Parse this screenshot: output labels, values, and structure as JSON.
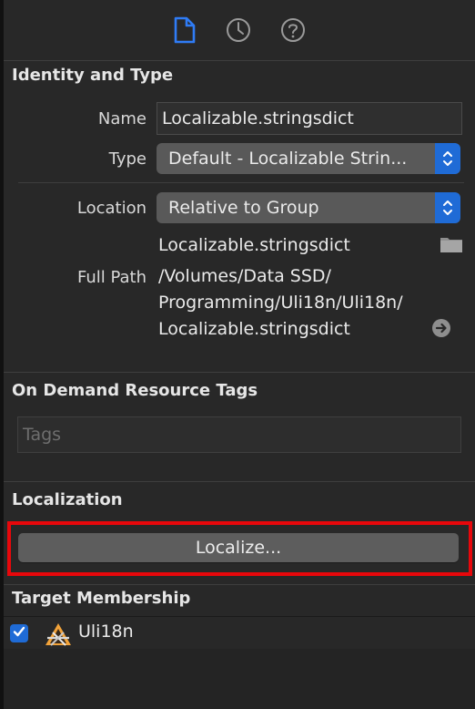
{
  "tabs": [
    {
      "name": "file-inspector",
      "icon": "document-icon",
      "active": true
    },
    {
      "name": "history-inspector",
      "icon": "clock-icon",
      "active": false
    },
    {
      "name": "quick-help",
      "icon": "question-icon",
      "active": false
    }
  ],
  "identity": {
    "header": "Identity and Type",
    "name_label": "Name",
    "name_value": "Localizable.stringsdict",
    "type_label": "Type",
    "type_value": "Default - Localizable Strin...",
    "location_label": "Location",
    "location_value": "Relative to Group",
    "location_file": "Localizable.stringsdict",
    "fullpath_label": "Full Path",
    "fullpath_lines": [
      "/Volumes/Data SSD/",
      "Programming/Uli18n/Uli18n/",
      "Localizable.stringsdict"
    ]
  },
  "ondemand": {
    "header": "On Demand Resource Tags",
    "tags_placeholder": "Tags"
  },
  "localization": {
    "header": "Localization",
    "button_label": "Localize..."
  },
  "target": {
    "header": "Target Membership",
    "items": [
      {
        "label": "Uli18n",
        "checked": true,
        "icon": "app-target-icon"
      }
    ]
  },
  "colors": {
    "accent": "#1f6bd6",
    "highlight": "#e8070b"
  }
}
